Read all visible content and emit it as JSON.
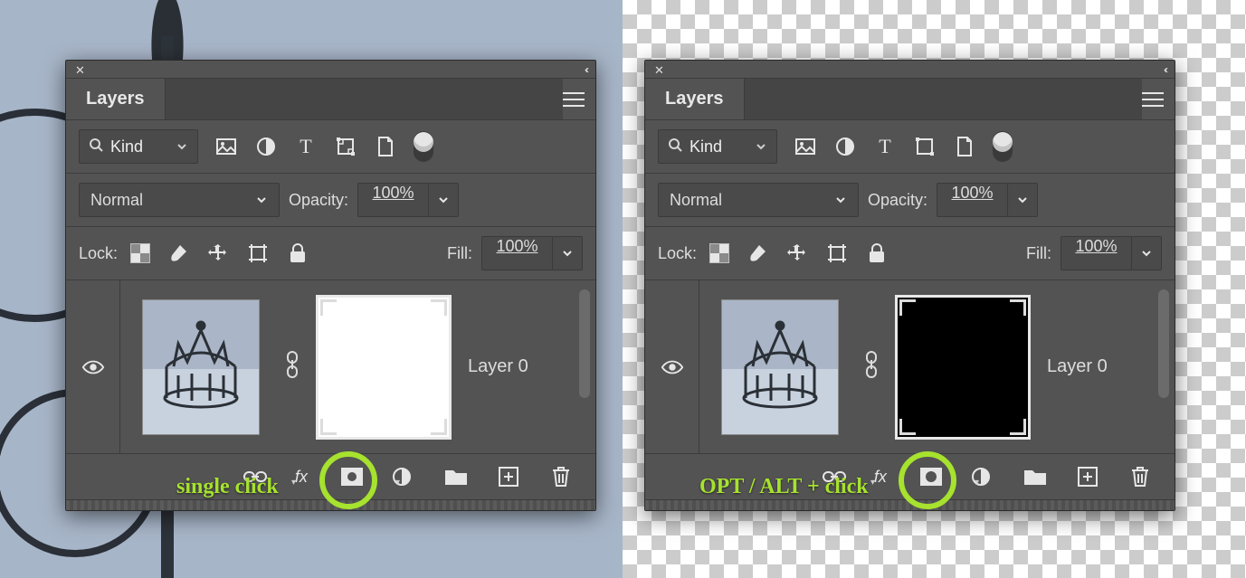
{
  "left": {
    "callout": "single click",
    "panel": {
      "title": "Layers",
      "kind_label": "Kind",
      "blend_mode": "Normal",
      "opacity_label": "Opacity:",
      "opacity_value": "100%",
      "lock_label": "Lock:",
      "fill_label": "Fill:",
      "fill_value": "100%",
      "layer_name": "Layer 0",
      "fx_label": "fx",
      "mask_color": "white"
    }
  },
  "right": {
    "callout": "OPT / ALT + click",
    "panel": {
      "title": "Layers",
      "kind_label": "Kind",
      "blend_mode": "Normal",
      "opacity_label": "Opacity:",
      "opacity_value": "100%",
      "lock_label": "Lock:",
      "fill_label": "Fill:",
      "fill_value": "100%",
      "layer_name": "Layer 0",
      "fx_label": "fx",
      "mask_color": "black"
    }
  }
}
